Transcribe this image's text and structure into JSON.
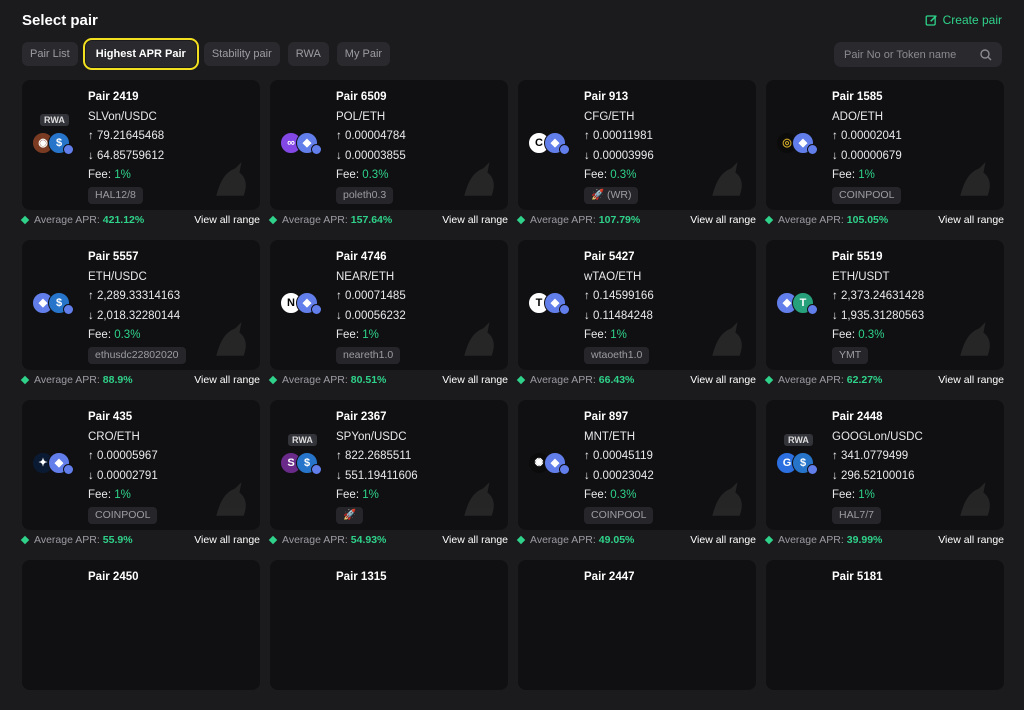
{
  "header": {
    "title": "Select pair",
    "create_label": "Create pair"
  },
  "tabs": [
    "Pair List",
    "Highest APR Pair",
    "Stability pair",
    "RWA",
    "My Pair"
  ],
  "search": {
    "placeholder": "Pair No or Token name"
  },
  "footer_labels": {
    "average_apr": "Average APR:",
    "view_range": "View all range"
  },
  "colors": {
    "accent": "#2fd28a",
    "highlight": "#f2df1f",
    "card": "#101012",
    "bg": "#1b1b1d"
  },
  "pairs": [
    {
      "pair": "Pair 2419",
      "tokens": "SLVon/USDC",
      "up": "79.21645468",
      "down": "64.85759612",
      "fee": "1%",
      "tag": "HAL12/8",
      "apr": "421.12%",
      "rwa": "RWA",
      "icons": [
        "silver",
        "usdc"
      ]
    },
    {
      "pair": "Pair 6509",
      "tokens": "POL/ETH",
      "up": "0.00004784",
      "down": "0.00003855",
      "fee": "0.3%",
      "tag": "poleth0.3",
      "apr": "157.64%",
      "icons": [
        "pol",
        "eth"
      ]
    },
    {
      "pair": "Pair 913",
      "tokens": "CFG/ETH",
      "up": "0.00011981",
      "down": "0.00003996",
      "fee": "0.3%",
      "tag": "🚀 (WR)",
      "apr": "107.79%",
      "icons": [
        "cfg",
        "eth"
      ]
    },
    {
      "pair": "Pair 1585",
      "tokens": "ADO/ETH",
      "up": "0.00002041",
      "down": "0.00000679",
      "fee": "1%",
      "tag": "COINPOOL",
      "apr": "105.05%",
      "icons": [
        "ado",
        "eth"
      ]
    },
    {
      "pair": "Pair 5557",
      "tokens": "ETH/USDC",
      "up": "2,289.33314163",
      "down": "2,018.32280144",
      "fee": "0.3%",
      "tag": "ethusdc22802020",
      "apr": "88.9%",
      "icons": [
        "eth",
        "usdc"
      ]
    },
    {
      "pair": "Pair 4746",
      "tokens": "NEAR/ETH",
      "up": "0.00071485",
      "down": "0.00056232",
      "fee": "1%",
      "tag": "neareth1.0",
      "apr": "80.51%",
      "icons": [
        "near",
        "eth"
      ]
    },
    {
      "pair": "Pair 5427",
      "tokens": "wTAO/ETH",
      "up": "0.14599166",
      "down": "0.11484248",
      "fee": "1%",
      "tag": "wtaoeth1.0",
      "apr": "66.43%",
      "icons": [
        "tao",
        "eth"
      ]
    },
    {
      "pair": "Pair 5519",
      "tokens": "ETH/USDT",
      "up": "2,373.24631428",
      "down": "1,935.31280563",
      "fee": "0.3%",
      "tag": "YMT",
      "apr": "62.27%",
      "icons": [
        "eth",
        "usdt"
      ]
    },
    {
      "pair": "Pair 435",
      "tokens": "CRO/ETH",
      "up": "0.00005967",
      "down": "0.00002791",
      "fee": "1%",
      "tag": "COINPOOL",
      "apr": "55.9%",
      "icons": [
        "cro",
        "eth"
      ]
    },
    {
      "pair": "Pair 2367",
      "tokens": "SPYon/USDC",
      "up": "822.2685511",
      "down": "551.19411606",
      "fee": "1%",
      "tag": "🚀",
      "apr": "54.93%",
      "rwa": "RWA",
      "icons": [
        "spy",
        "usdc"
      ]
    },
    {
      "pair": "Pair 897",
      "tokens": "MNT/ETH",
      "up": "0.00045119",
      "down": "0.00023042",
      "fee": "0.3%",
      "tag": "COINPOOL",
      "apr": "49.05%",
      "icons": [
        "mnt",
        "eth"
      ]
    },
    {
      "pair": "Pair 2448",
      "tokens": "GOOGLon/USDC",
      "up": "341.0779499",
      "down": "296.52100016",
      "fee": "1%",
      "tag": "HAL7/7",
      "apr": "39.99%",
      "rwa": "RWA",
      "icons": [
        "goog",
        "usdc"
      ]
    },
    {
      "pair": "Pair 2450"
    },
    {
      "pair": "Pair 1315"
    },
    {
      "pair": "Pair 2447"
    },
    {
      "pair": "Pair 5181"
    }
  ]
}
